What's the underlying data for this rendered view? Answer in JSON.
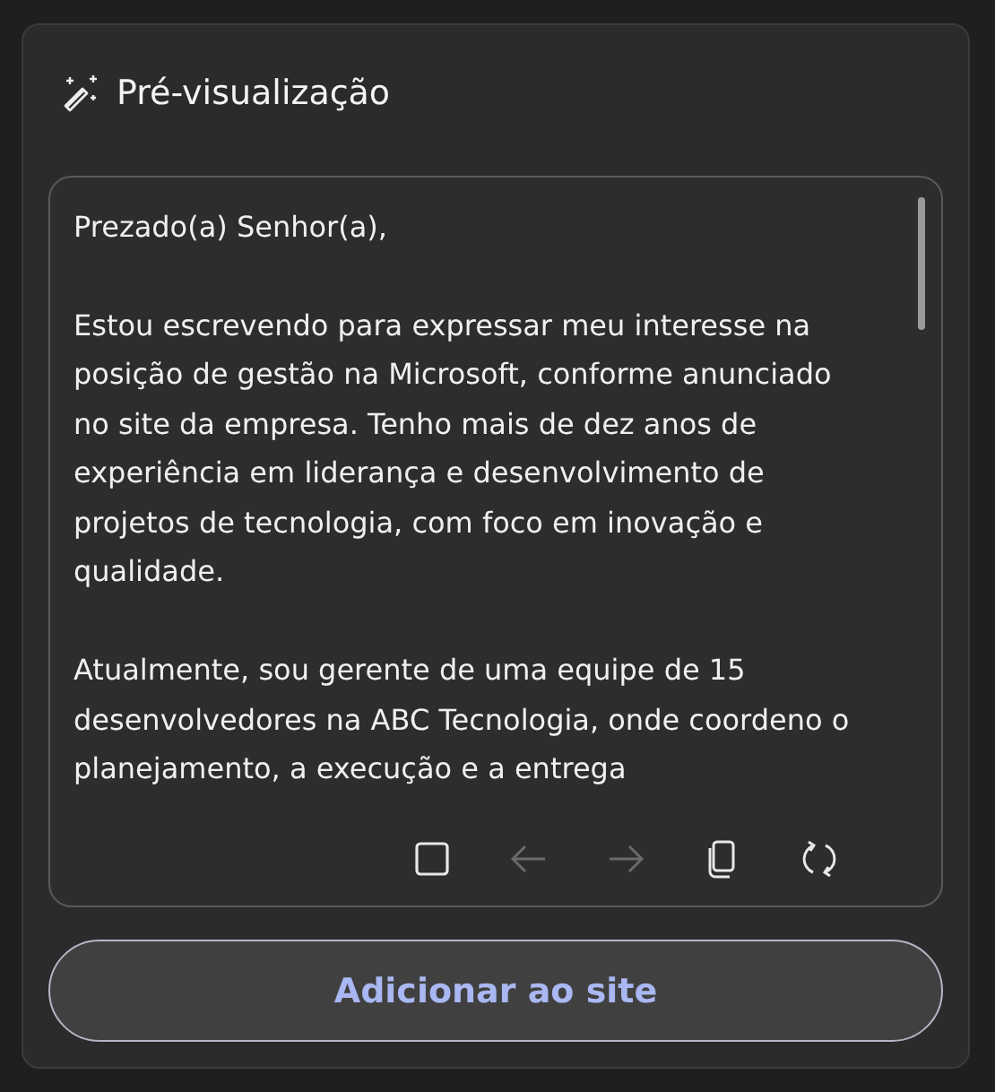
{
  "header": {
    "title": "Pré-visualização"
  },
  "preview": {
    "paragraphs": [
      "Prezado(a) Senhor(a),",
      "Estou escrevendo para expressar meu interesse na posição de gestão na Microsoft, conforme anunciado no site da empresa. Tenho mais de dez anos de experiência em liderança e desenvolvimento de projetos de tecnologia, com foco em inovação e qualidade.",
      "Atualmente, sou gerente de uma equipe de 15 desenvolvedores na ABC Tecnologia, onde coordeno o planejamento, a execução e a entrega"
    ]
  },
  "toolbar": [
    {
      "kind": "stop",
      "disabled": false
    },
    {
      "kind": "back",
      "disabled": true
    },
    {
      "kind": "forward",
      "disabled": true
    },
    {
      "kind": "copy",
      "disabled": false
    },
    {
      "kind": "regenerate",
      "disabled": false
    }
  ],
  "action_button": {
    "label": "Adicionar ao site"
  }
}
